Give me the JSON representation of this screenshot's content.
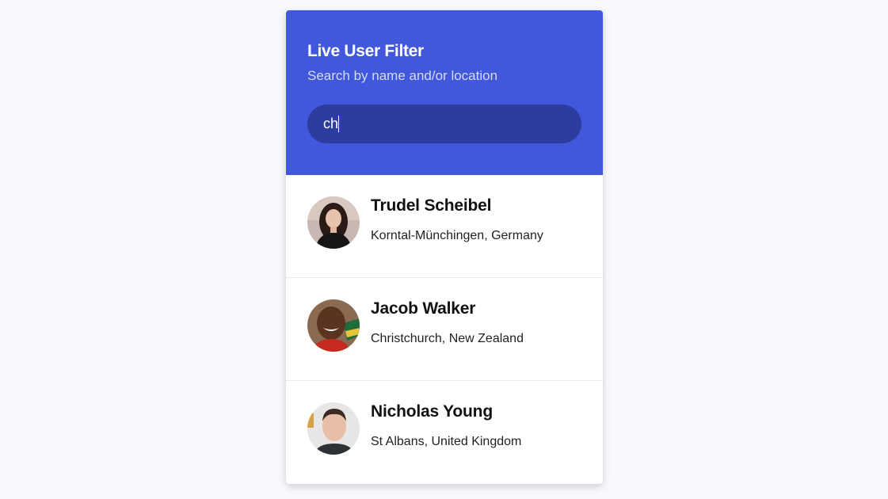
{
  "header": {
    "title": "Live User Filter",
    "subtitle": "Search by name and/or location"
  },
  "search": {
    "value": "ch",
    "placeholder": "Search"
  },
  "users": [
    {
      "name": "Trudel Scheibel",
      "location": "Korntal-Münchingen, Germany",
      "avatar_icon": "avatar-woman-dark-hair"
    },
    {
      "name": "Jacob Walker",
      "location": "Christchurch, New Zealand",
      "avatar_icon": "avatar-man-smiling"
    },
    {
      "name": "Nicholas Young",
      "location": "St Albans, United Kingdom",
      "avatar_icon": "avatar-man-short-hair"
    }
  ],
  "colors": {
    "header_bg": "#4157dc",
    "search_bg": "#2c3d9e",
    "page_bg": "#f8f9fd"
  }
}
